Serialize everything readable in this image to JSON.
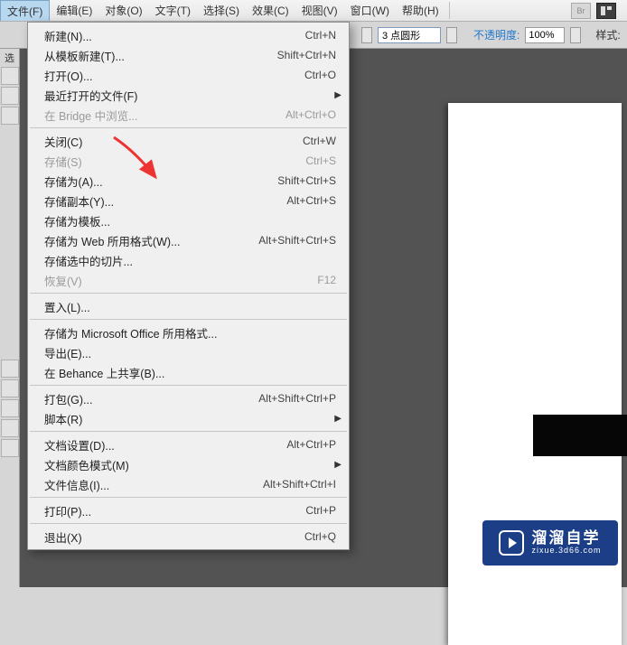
{
  "menubar": {
    "items": [
      {
        "label": "文件(F)",
        "active": true
      },
      {
        "label": "编辑(E)"
      },
      {
        "label": "对象(O)"
      },
      {
        "label": "文字(T)"
      },
      {
        "label": "选择(S)"
      },
      {
        "label": "效果(C)"
      },
      {
        "label": "视图(V)"
      },
      {
        "label": "窗口(W)"
      },
      {
        "label": "帮助(H)"
      }
    ]
  },
  "toolbar": {
    "stroke_value": "3 点圆形",
    "opacity_label": "不透明度:",
    "opacity_value": "100%",
    "style_label": "样式:"
  },
  "dropdown": [
    {
      "type": "item",
      "label": "新建(N)...",
      "shortcut": "Ctrl+N"
    },
    {
      "type": "item",
      "label": "从模板新建(T)...",
      "shortcut": "Shift+Ctrl+N"
    },
    {
      "type": "item",
      "label": "打开(O)...",
      "shortcut": "Ctrl+O"
    },
    {
      "type": "item",
      "label": "最近打开的文件(F)",
      "submenu": true
    },
    {
      "type": "item",
      "label": "在 Bridge 中浏览...",
      "shortcut": "Alt+Ctrl+O",
      "disabled": true
    },
    {
      "type": "sep"
    },
    {
      "type": "item",
      "label": "关闭(C)",
      "shortcut": "Ctrl+W"
    },
    {
      "type": "item",
      "label": "存储(S)",
      "shortcut": "Ctrl+S",
      "disabled": true
    },
    {
      "type": "item",
      "label": "存储为(A)...",
      "shortcut": "Shift+Ctrl+S"
    },
    {
      "type": "item",
      "label": "存储副本(Y)...",
      "shortcut": "Alt+Ctrl+S"
    },
    {
      "type": "item",
      "label": "存储为模板..."
    },
    {
      "type": "item",
      "label": "存储为 Web 所用格式(W)...",
      "shortcut": "Alt+Shift+Ctrl+S"
    },
    {
      "type": "item",
      "label": "存储选中的切片..."
    },
    {
      "type": "item",
      "label": "恢复(V)",
      "shortcut": "F12",
      "disabled": true
    },
    {
      "type": "sep"
    },
    {
      "type": "item",
      "label": "置入(L)..."
    },
    {
      "type": "sep"
    },
    {
      "type": "item",
      "label": "存储为 Microsoft Office 所用格式..."
    },
    {
      "type": "item",
      "label": "导出(E)..."
    },
    {
      "type": "item",
      "label": "在 Behance 上共享(B)..."
    },
    {
      "type": "sep"
    },
    {
      "type": "item",
      "label": "打包(G)...",
      "shortcut": "Alt+Shift+Ctrl+P"
    },
    {
      "type": "item",
      "label": "脚本(R)",
      "submenu": true
    },
    {
      "type": "sep"
    },
    {
      "type": "item",
      "label": "文档设置(D)...",
      "shortcut": "Alt+Ctrl+P"
    },
    {
      "type": "item",
      "label": "文档颜色模式(M)",
      "submenu": true
    },
    {
      "type": "item",
      "label": "文件信息(I)...",
      "shortcut": "Alt+Shift+Ctrl+I"
    },
    {
      "type": "sep"
    },
    {
      "type": "item",
      "label": "打印(P)...",
      "shortcut": "Ctrl+P"
    },
    {
      "type": "sep"
    },
    {
      "type": "item",
      "label": "退出(X)",
      "shortcut": "Ctrl+Q"
    }
  ],
  "watermark": {
    "line1": "溜溜自学",
    "line2": "zixue.3d66.com"
  },
  "leftpanel": {
    "label": "选"
  }
}
